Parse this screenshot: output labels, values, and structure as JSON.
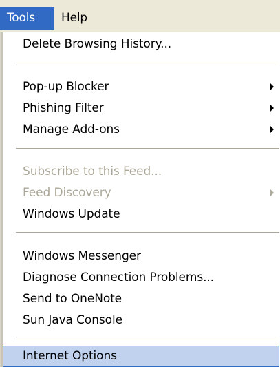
{
  "menubar": {
    "tools_label": "Tools",
    "help_label": "Help"
  },
  "menu": {
    "items": [
      {
        "label": "Delete Browsing History...",
        "enabled": true,
        "submenu": false
      },
      {
        "label": "Pop-up Blocker",
        "enabled": true,
        "submenu": true
      },
      {
        "label": "Phishing Filter",
        "enabled": true,
        "submenu": true
      },
      {
        "label": "Manage Add-ons",
        "enabled": true,
        "submenu": true
      },
      {
        "label": "Subscribe to this Feed...",
        "enabled": false,
        "submenu": false
      },
      {
        "label": "Feed Discovery",
        "enabled": false,
        "submenu": true
      },
      {
        "label": "Windows Update",
        "enabled": true,
        "submenu": false
      },
      {
        "label": "Windows Messenger",
        "enabled": true,
        "submenu": false
      },
      {
        "label": "Diagnose Connection Problems...",
        "enabled": true,
        "submenu": false
      },
      {
        "label": "Send to OneNote",
        "enabled": true,
        "submenu": false
      },
      {
        "label": "Sun Java Console",
        "enabled": true,
        "submenu": false
      },
      {
        "label": "Internet Options",
        "enabled": true,
        "submenu": false,
        "highlighted": true
      }
    ]
  },
  "colors": {
    "menubar_bg": "#ECE9D8",
    "active_menu_bg": "#316AC5",
    "highlight_bg": "#C1D2EE",
    "disabled_text": "#ACA899",
    "separator": "#ACA899"
  },
  "icons": {
    "submenu_arrow": "submenu-arrow-icon"
  }
}
